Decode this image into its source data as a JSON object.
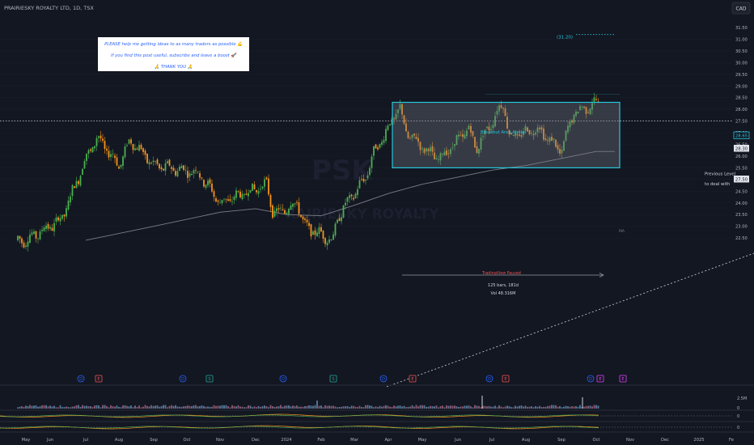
{
  "header": {
    "symbol_title": "PRAIRIESKY ROYALTY LTD, 1D, TSX",
    "currency": "CAD"
  },
  "watermark": {
    "ticker": "PSK",
    "name": "PRAIRIESKY ROYALTY"
  },
  "note_box": {
    "line1": "PLEASE help me getting ideas to as many traders as possible 💪",
    "line2": "If you find this post useful, subscribe and leave a boost 🚀",
    "line3": "🙏 THANK YOU 🙏"
  },
  "annotations": {
    "target_label": "(31.20)",
    "breakout_label": "Breakout Area Above",
    "previous_level_line1": "Previous Level",
    "previous_level_line2": "to deal with",
    "range_label": "TradingView Paused",
    "range_stats_line1": "125 bars, 181d",
    "range_stats_line2": "Vol 48.316M",
    "ma_tag": "MA"
  },
  "price_tags": {
    "top_value": "28.65",
    "current_value": "28.30",
    "previous_level_value": "27.50"
  },
  "colors": {
    "background": "#131722",
    "bull": "#4caf50",
    "bear": "#f7931e",
    "range_box": "#26c6da",
    "moving_average": "#9598a1",
    "event_blue": "#2962ff",
    "event_red": "#ef5350",
    "event_green": "#26a69a",
    "event_purple": "#e040fb"
  },
  "chart_data": {
    "type": "candlestick",
    "timeframe": "1D",
    "y_axis": {
      "ticks": [
        "31.50",
        "31.00",
        "30.50",
        "30.00",
        "29.50",
        "29.00",
        "28.50",
        "28.00",
        "27.50",
        "27.00",
        "26.50",
        "26.00",
        "25.50",
        "25.00",
        "24.50",
        "24.00",
        "23.50",
        "23.00",
        "22.50"
      ],
      "ylim": [
        22.3,
        31.8
      ]
    },
    "x_axis": {
      "ticks": [
        "May",
        "Jun",
        "Jul",
        "Aug",
        "Sep",
        "Oct",
        "Nov",
        "Dec",
        "2024",
        "Feb",
        "Mar",
        "Apr",
        "May",
        "Jun",
        "Jul",
        "Aug",
        "Sep",
        "Oct",
        "Nov",
        "Dec",
        "2025",
        "Fe"
      ]
    },
    "price_path": [
      {
        "month": "May",
        "close": 22.4
      },
      {
        "month": "Jun",
        "close": 23.3
      },
      {
        "month": "Jul",
        "close": 25.9
      },
      {
        "month": "Jul",
        "close": 26.8
      },
      {
        "month": "Aug",
        "close": 25.6
      },
      {
        "month": "Aug",
        "close": 26.7
      },
      {
        "month": "Sep",
        "close": 25.6
      },
      {
        "month": "Oct",
        "close": 25.3
      },
      {
        "month": "Nov",
        "close": 24.0
      },
      {
        "month": "Dec",
        "close": 24.8
      },
      {
        "month": "Dec",
        "close": 23.5
      },
      {
        "month": "2024",
        "close": 24.0
      },
      {
        "month": "2024",
        "close": 23.0
      },
      {
        "month": "Feb",
        "close": 22.4
      },
      {
        "month": "Feb",
        "close": 23.5
      },
      {
        "month": "Mar",
        "close": 25.1
      },
      {
        "month": "Mar",
        "close": 26.0
      },
      {
        "month": "Apr",
        "close": 28.1
      },
      {
        "month": "Apr",
        "close": 27.0
      },
      {
        "month": "May",
        "close": 26.0
      },
      {
        "month": "May",
        "close": 25.9
      },
      {
        "month": "Jun",
        "close": 27.2
      },
      {
        "month": "Jun",
        "close": 26.3
      },
      {
        "month": "Jul",
        "close": 28.3
      },
      {
        "month": "Jul",
        "close": 26.8
      },
      {
        "month": "Aug",
        "close": 27.2
      },
      {
        "month": "Sep",
        "close": 26.2
      },
      {
        "month": "Sep",
        "close": 27.8
      },
      {
        "month": "Oct",
        "close": 28.3
      }
    ],
    "moving_average": [
      {
        "month": "Jul",
        "value": 22.4
      },
      {
        "month": "Sep",
        "value": 23.0
      },
      {
        "month": "Nov",
        "value": 23.6
      },
      {
        "month": "Dec",
        "value": 23.75
      },
      {
        "month": "2024",
        "value": 23.5
      },
      {
        "month": "Feb",
        "value": 23.45
      },
      {
        "month": "Mar",
        "value": 23.9
      },
      {
        "month": "Apr",
        "value": 24.4
      },
      {
        "month": "May",
        "value": 24.8
      },
      {
        "month": "Jun",
        "value": 25.1
      },
      {
        "month": "Jul",
        "value": 25.4
      },
      {
        "month": "Aug",
        "value": 25.6
      },
      {
        "month": "Sep",
        "value": 25.9
      },
      {
        "month": "Oct",
        "value": 26.2
      }
    ],
    "range_box": {
      "start": "Apr",
      "end": "Oct",
      "top": 28.3,
      "bottom": 25.5
    },
    "horizontal_levels": [
      {
        "value": 31.2,
        "style": "dotted"
      },
      {
        "value": 27.5,
        "style": "dotted"
      }
    ],
    "events": [
      {
        "label": "D",
        "month": "Jun",
        "kind": "dividend"
      },
      {
        "label": "E",
        "month": "Jul",
        "kind": "earnings"
      },
      {
        "label": "D",
        "month": "Sep",
        "kind": "dividend"
      },
      {
        "label": "S",
        "month": "Oct",
        "kind": "split"
      },
      {
        "label": "D",
        "month": "Dec",
        "kind": "dividend"
      },
      {
        "label": "S",
        "month": "Feb",
        "kind": "split"
      },
      {
        "label": "D",
        "month": "Apr",
        "kind": "dividend"
      },
      {
        "label": "E",
        "month": "Apr",
        "kind": "earnings"
      },
      {
        "label": "D",
        "month": "Jun",
        "kind": "dividend"
      },
      {
        "label": "E",
        "month": "Jul",
        "kind": "earnings"
      },
      {
        "label": "D",
        "month": "Sep",
        "kind": "dividend"
      },
      {
        "label": "E",
        "month": "Oct",
        "kind": "earnings"
      },
      {
        "label": "E",
        "month": "Nov",
        "kind": "earnings"
      }
    ],
    "volume_axis": {
      "top_label": "2.5M",
      "zero_label": "0"
    },
    "indicator_axes": [
      {
        "zero_label": "0"
      },
      {
        "zero_label": "0"
      }
    ]
  }
}
